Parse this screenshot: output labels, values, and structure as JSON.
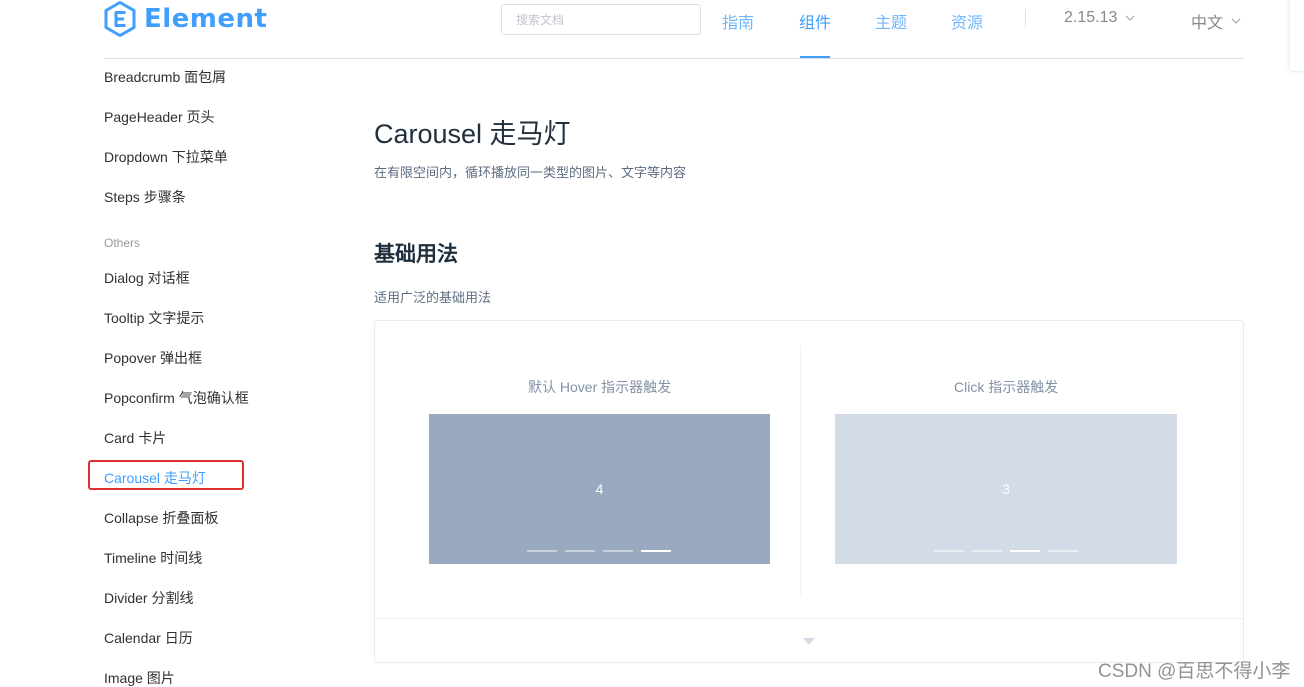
{
  "header": {
    "logo_text": "Element",
    "search_placeholder": "搜索文档",
    "nav": [
      {
        "label": "指南",
        "active": false
      },
      {
        "label": "组件",
        "active": true
      },
      {
        "label": "主题",
        "active": false
      },
      {
        "label": "资源",
        "active": false
      }
    ],
    "version": "2.15.13",
    "language": "中文",
    "accent_color": "#409eff"
  },
  "sidebar": {
    "items_top": [
      "Breadcrumb 面包屑",
      "PageHeader 页头",
      "Dropdown 下拉菜单",
      "Steps 步骤条"
    ],
    "group_label": "Others",
    "items_others": [
      "Dialog 对话框",
      "Tooltip 文字提示",
      "Popover 弹出框",
      "Popconfirm 气泡确认框",
      "Card 卡片",
      "Carousel 走马灯",
      "Collapse 折叠面板",
      "Timeline 时间线",
      "Divider 分割线",
      "Calendar 日历",
      "Image 图片"
    ],
    "active_item": "Carousel 走马灯"
  },
  "main": {
    "title": "Carousel 走马灯",
    "description": "在有限空间内，循环播放同一类型的图片、文字等内容",
    "section_title": "基础用法",
    "section_description": "适用广泛的基础用法",
    "demos": [
      {
        "label": "默认 Hover 指示器触发",
        "current_slide": "4",
        "indicator_count": 4,
        "active_indicator": 4,
        "color": "#99a9bf"
      },
      {
        "label": "Click 指示器触发",
        "current_slide": "3",
        "indicator_count": 4,
        "active_indicator": 3,
        "color": "#d3dce6"
      }
    ]
  },
  "watermark": "CSDN @百思不得小李"
}
